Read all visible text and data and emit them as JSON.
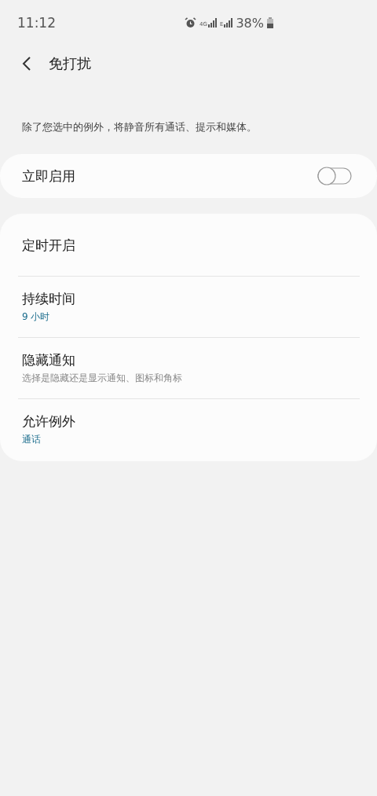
{
  "status_bar": {
    "time": "11:12",
    "network_labels": [
      "4G",
      "E"
    ],
    "battery": "38%"
  },
  "header": {
    "title": "免打扰"
  },
  "description": "除了您选中的例外，将静音所有通话、提示和媒体。",
  "toggle_row": {
    "label": "立即启用",
    "checked": false
  },
  "settings": [
    {
      "kind": "plain",
      "title": "定时开启"
    },
    {
      "kind": "value",
      "title": "持续时间",
      "subtitle": "9 小时"
    },
    {
      "kind": "description",
      "title": "隐藏通知",
      "subtitle": "选择是隐藏还是显示通知、图标和角标"
    },
    {
      "kind": "value",
      "title": "允许例外",
      "subtitle": "通话"
    }
  ]
}
